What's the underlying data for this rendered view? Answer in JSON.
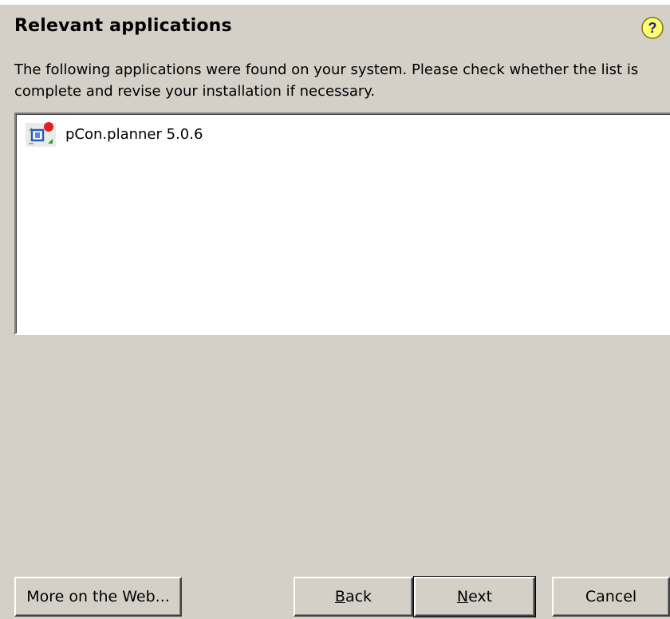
{
  "page": {
    "title": "Relevant applications",
    "description": "The following applications were found on your system. Please check whether the list is complete and revise your installation if necessary."
  },
  "applications": [
    {
      "name": "pCon.planner 5.0.6",
      "icon": "pcon-planner-icon"
    }
  ],
  "buttons": {
    "more_web": "More on the Web...",
    "back_mnemonic": "B",
    "back_rest": "ack",
    "next_mnemonic": "N",
    "next_rest": "ext",
    "cancel": "Cancel"
  },
  "icons": {
    "help": "help-icon"
  },
  "colors": {
    "background": "#d4d0c8",
    "help_icon_fill": "#ffff66"
  }
}
